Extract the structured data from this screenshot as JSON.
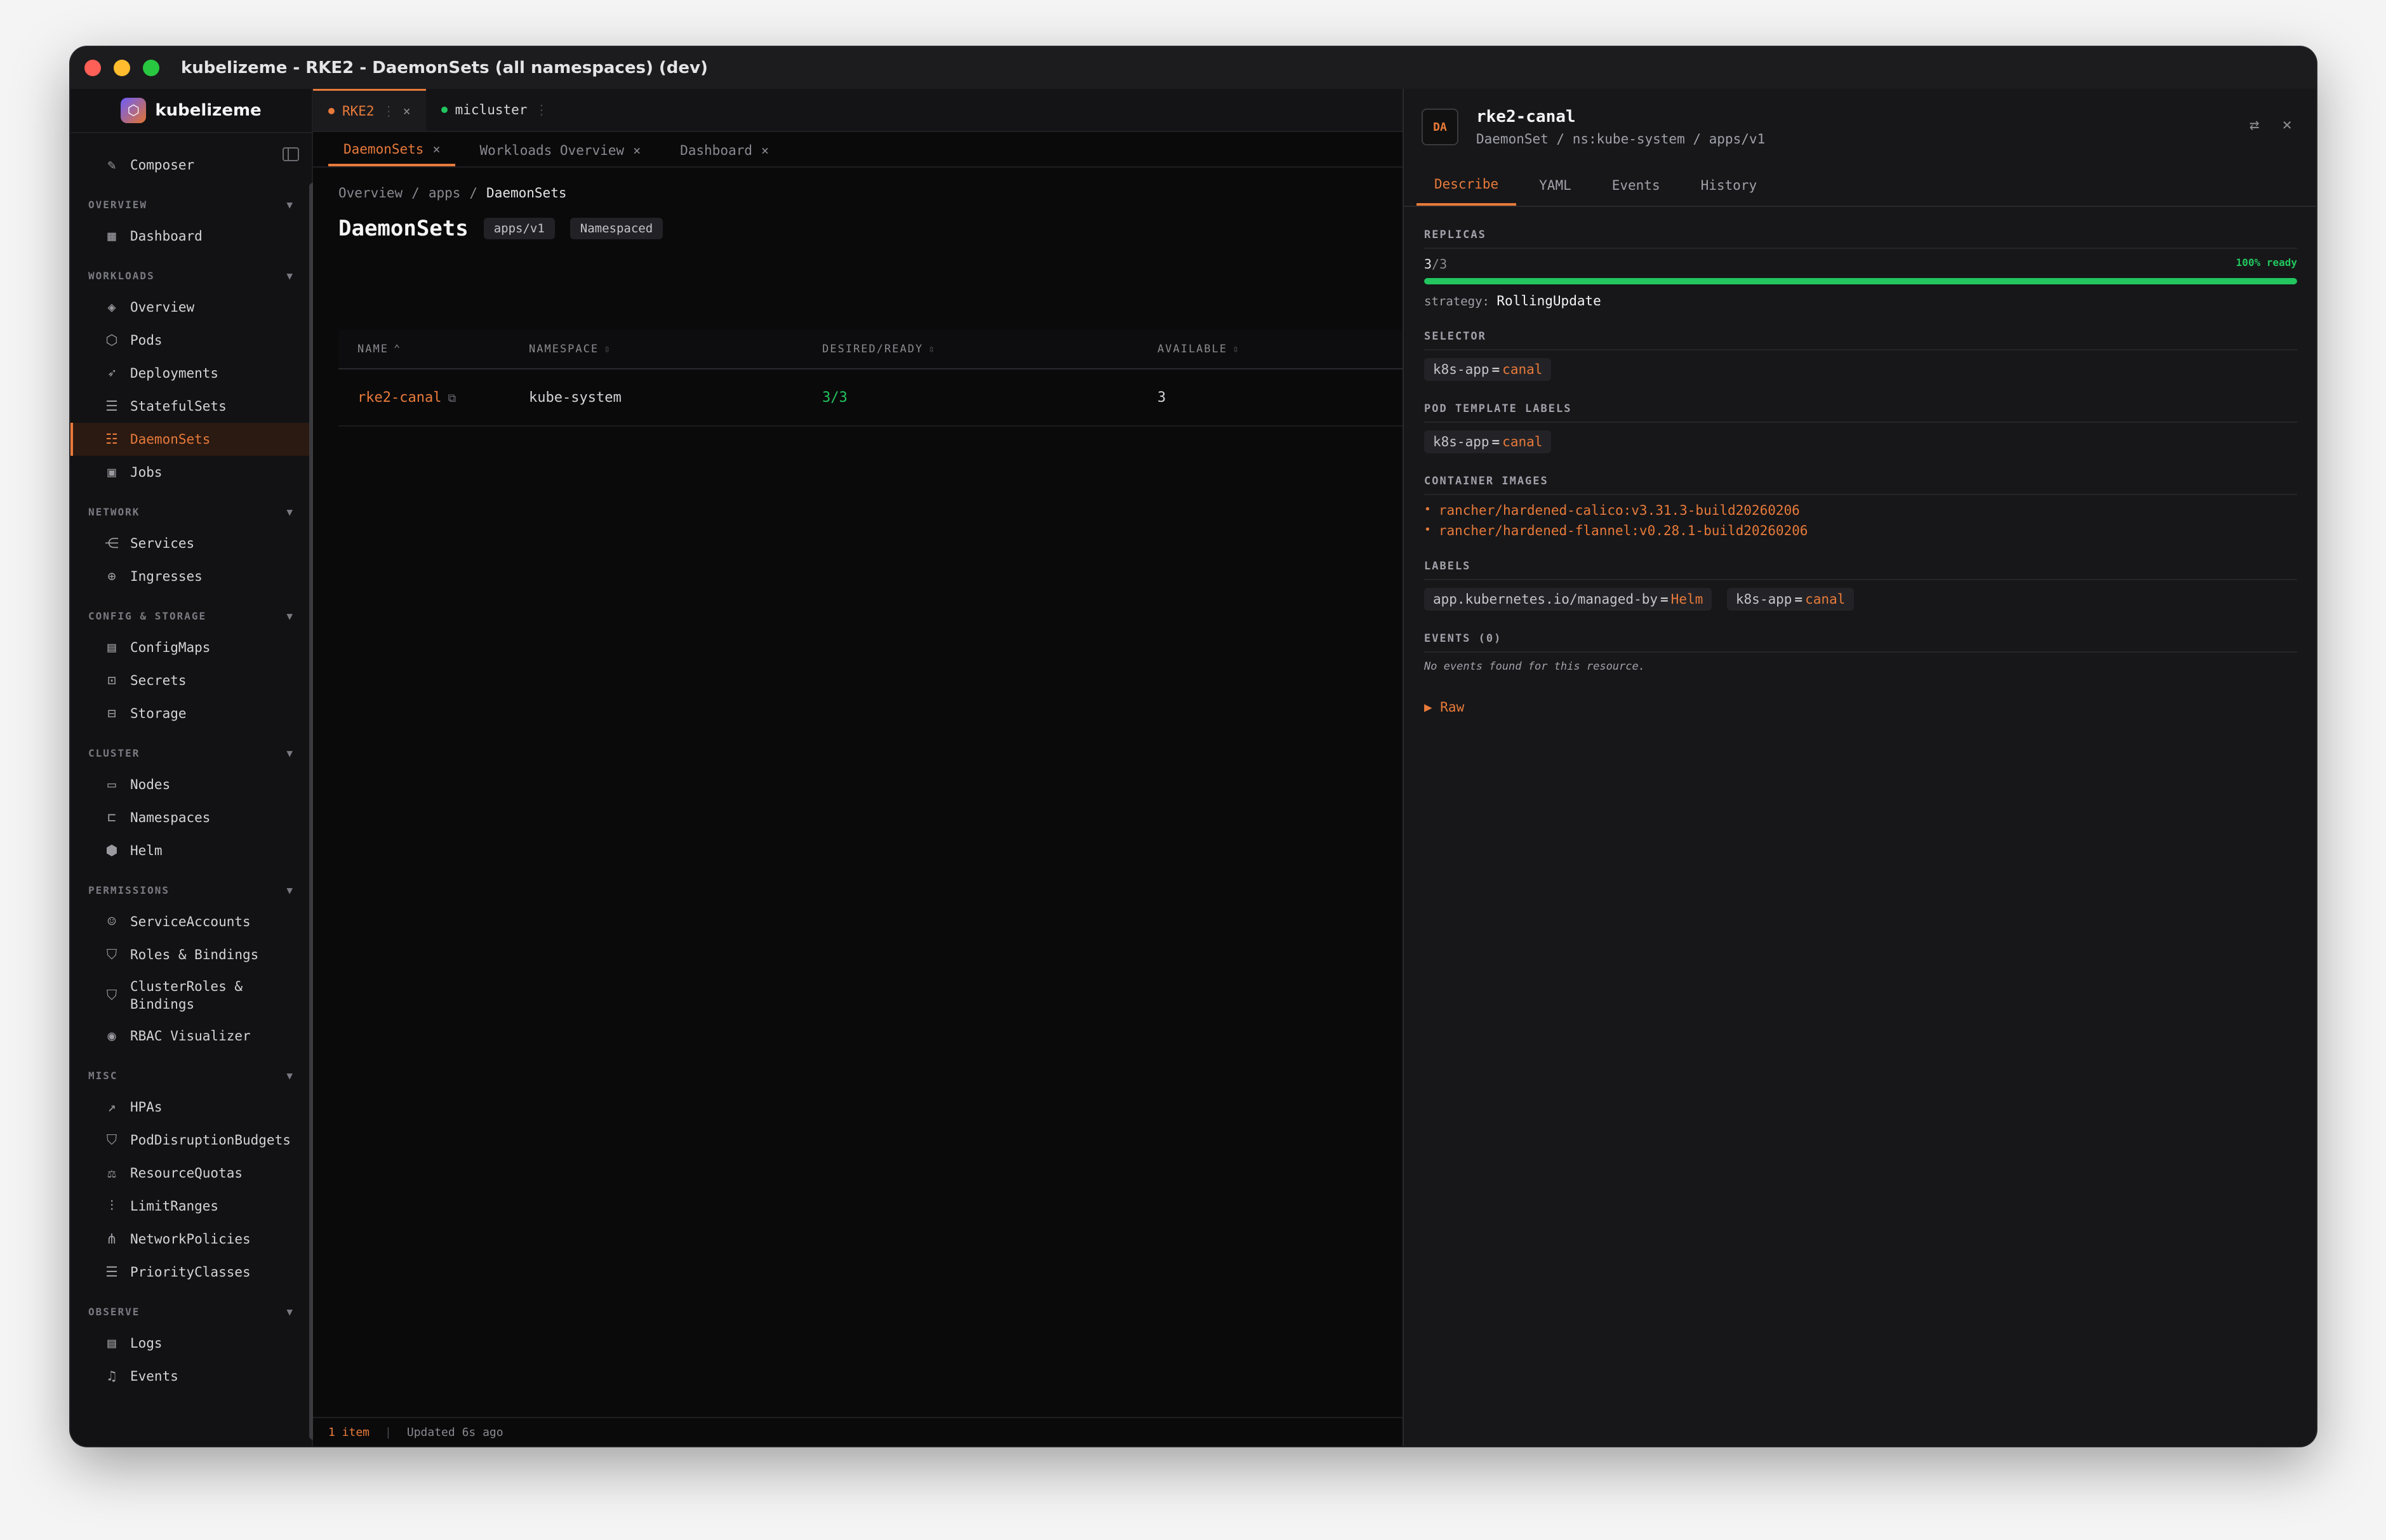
{
  "window": {
    "title": "kubelizeme - RKE2 - DaemonSets (all namespaces) (dev)"
  },
  "brand": {
    "name": "kubelizeme"
  },
  "sidebar": {
    "composer": "Composer",
    "sections": [
      {
        "title": "OVERVIEW",
        "items": [
          {
            "label": "Dashboard",
            "icon": "dashboard-icon",
            "glyph": "▦"
          }
        ]
      },
      {
        "title": "WORKLOADS",
        "items": [
          {
            "label": "Overview",
            "icon": "layers-icon",
            "glyph": "◈"
          },
          {
            "label": "Pods",
            "icon": "cube-icon",
            "glyph": "⬡"
          },
          {
            "label": "Deployments",
            "icon": "rocket-icon",
            "glyph": "➶"
          },
          {
            "label": "StatefulSets",
            "icon": "database-icon",
            "glyph": "☰"
          },
          {
            "label": "DaemonSets",
            "icon": "server-icon",
            "glyph": "☷",
            "active": true
          },
          {
            "label": "Jobs",
            "icon": "briefcase-icon",
            "glyph": "▣"
          }
        ]
      },
      {
        "title": "NETWORK",
        "items": [
          {
            "label": "Services",
            "icon": "share-icon",
            "glyph": "⋲"
          },
          {
            "label": "Ingresses",
            "icon": "globe-icon",
            "glyph": "⊕"
          }
        ]
      },
      {
        "title": "CONFIG & STORAGE",
        "items": [
          {
            "label": "ConfigMaps",
            "icon": "file-icon",
            "glyph": "▤"
          },
          {
            "label": "Secrets",
            "icon": "lock-icon",
            "glyph": "⊡"
          },
          {
            "label": "Storage",
            "icon": "drive-icon",
            "glyph": "⊟"
          }
        ]
      },
      {
        "title": "CLUSTER",
        "items": [
          {
            "label": "Nodes",
            "icon": "monitor-icon",
            "glyph": "▭"
          },
          {
            "label": "Namespaces",
            "icon": "folder-icon",
            "glyph": "⊏"
          },
          {
            "label": "Helm",
            "icon": "package-icon",
            "glyph": "⬢"
          }
        ]
      },
      {
        "title": "PERMISSIONS",
        "items": [
          {
            "label": "ServiceAccounts",
            "icon": "user-icon",
            "glyph": "☺"
          },
          {
            "label": "Roles & Bindings",
            "icon": "shield-icon",
            "glyph": "⛉"
          },
          {
            "label": "ClusterRoles &\nBindings",
            "icon": "shield-check-icon",
            "glyph": "⛉",
            "tall": true
          },
          {
            "label": "RBAC Visualizer",
            "icon": "eye-icon",
            "glyph": "◉"
          }
        ]
      },
      {
        "title": "MISC",
        "items": [
          {
            "label": "HPAs",
            "icon": "trending-up-icon",
            "glyph": "↗"
          },
          {
            "label": "PodDisruptionBudgets",
            "icon": "shield-alert-icon",
            "glyph": "⛉"
          },
          {
            "label": "ResourceQuotas",
            "icon": "scale-icon",
            "glyph": "⚖"
          },
          {
            "label": "LimitRanges",
            "icon": "sliders-icon",
            "glyph": "⫶"
          },
          {
            "label": "NetworkPolicies",
            "icon": "network-icon",
            "glyph": "⋔"
          },
          {
            "label": "PriorityClasses",
            "icon": "list-ordered-icon",
            "glyph": "☰"
          }
        ]
      },
      {
        "title": "OBSERVE",
        "items": [
          {
            "label": "Logs",
            "icon": "scroll-icon",
            "glyph": "▤"
          },
          {
            "label": "Events",
            "icon": "bell-icon",
            "glyph": "♫"
          }
        ]
      }
    ]
  },
  "context_tabs": [
    {
      "label": "RKE2",
      "active": true
    },
    {
      "label": "micluster",
      "active": false
    }
  ],
  "view_tabs": [
    {
      "label": "DaemonSets",
      "active": true
    },
    {
      "label": "Workloads Overview",
      "active": false
    },
    {
      "label": "Dashboard",
      "active": false
    }
  ],
  "breadcrumb": [
    "Overview",
    "apps",
    "DaemonSets"
  ],
  "page": {
    "title": "DaemonSets",
    "badges": [
      "apps/v1",
      "Namespaced"
    ]
  },
  "table": {
    "columns": [
      "NAME",
      "NAMESPACE",
      "DESIRED/READY",
      "AVAILABLE"
    ],
    "rows": [
      {
        "name": "rke2-canal",
        "namespace": "kube-system",
        "desired_ready": "3/3",
        "available": "3"
      }
    ]
  },
  "footer": {
    "count": "1 item",
    "updated": "Updated 6s ago"
  },
  "detail": {
    "kind_abbr": "DA",
    "name": "rke2-canal",
    "meta": "DaemonSet / ns:kube-system / apps/v1",
    "tabs": [
      "Describe",
      "YAML",
      "Events",
      "History"
    ],
    "replicas": {
      "title": "REPLICAS",
      "ready": "3",
      "total": "/3",
      "ready_text": "100% ready",
      "ready_fraction": 1.0,
      "strategy_label": "strategy:",
      "strategy": "RollingUpdate"
    },
    "selector": {
      "title": "SELECTOR",
      "labels": [
        {
          "k": "k8s-app",
          "v": "canal"
        }
      ]
    },
    "pod_template_labels": {
      "title": "POD TEMPLATE LABELS",
      "labels": [
        {
          "k": "k8s-app",
          "v": "canal"
        }
      ]
    },
    "container_images": {
      "title": "CONTAINER IMAGES",
      "images": [
        "rancher/hardened-calico:v3.31.3-build20260206",
        "rancher/hardened-flannel:v0.28.1-build20260206"
      ]
    },
    "labels": {
      "title": "LABELS",
      "labels": [
        {
          "k": "app.kubernetes.io/managed-by",
          "v": "Helm"
        },
        {
          "k": "k8s-app",
          "v": "canal"
        }
      ]
    },
    "events": {
      "title": "EVENTS (0)",
      "empty": "No events found for this resource."
    },
    "raw": "▶ Raw"
  },
  "colors": {
    "accent": "#e87a3a",
    "success": "#22c55e",
    "bg": "#0a0a0b"
  }
}
